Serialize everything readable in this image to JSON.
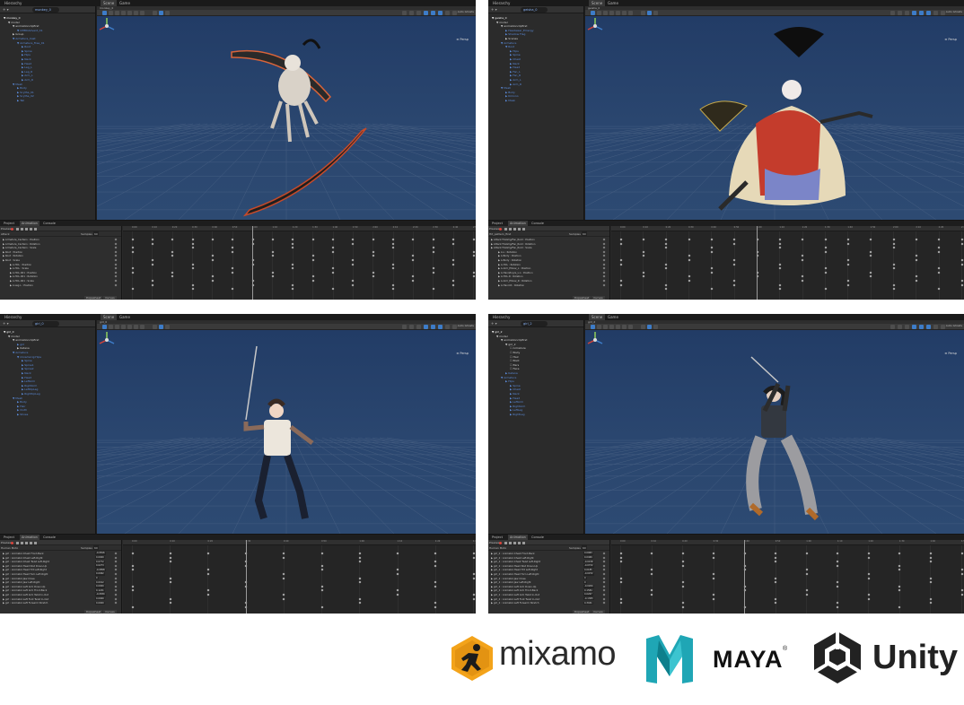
{
  "panels": [
    {
      "tabs": [
        "Hierarchy",
        "Scene",
        "Game"
      ],
      "search": "monkey_0",
      "scene_name": "monkey_0",
      "shading": "Auto Ghosts",
      "hierarchy": [
        {
          "label": "▼ monkey_0",
          "indent": 0,
          "style": "sel"
        },
        {
          "label": "▼ model",
          "indent": 1,
          "style": ""
        },
        {
          "label": "▼ animationclipfirst",
          "indent": 2,
          "style": ""
        },
        {
          "label": "▼ OHMCAdvent_01",
          "indent": 3,
          "style": "blue"
        },
        {
          "label": "▶ Group",
          "indent": 2,
          "style": ""
        },
        {
          "label": "▼ Armature_Cast",
          "indent": 2,
          "style": "blue"
        },
        {
          "label": "▼ Armature_Free_01",
          "indent": 3,
          "style": "blue"
        },
        {
          "label": "▶ Root",
          "indent": 4,
          "style": "blue"
        },
        {
          "label": "▶ Spine",
          "indent": 4,
          "style": "blue"
        },
        {
          "label": "▶ Hips",
          "indent": 4,
          "style": "blue"
        },
        {
          "label": "▶ Neck",
          "indent": 4,
          "style": "blue"
        },
        {
          "label": "▶ Head",
          "indent": 4,
          "style": "blue"
        },
        {
          "label": "▶ Leg_L",
          "indent": 4,
          "style": "blue"
        },
        {
          "label": "▶ Leg_R",
          "indent": 4,
          "style": "blue"
        },
        {
          "label": "▶ Arm_L",
          "indent": 4,
          "style": "blue"
        },
        {
          "label": "▶ Arm_R",
          "indent": 4,
          "style": "blue"
        },
        {
          "label": "▼ Mesh",
          "indent": 2,
          "style": "blue"
        },
        {
          "label": "▶ Body",
          "indent": 3,
          "style": "blue"
        },
        {
          "label": "▶ Scythe_01",
          "indent": 3,
          "style": "blue"
        },
        {
          "label": "▶ Scythe_02",
          "indent": 3,
          "style": "blue"
        },
        {
          "label": "▶ Tail",
          "indent": 3,
          "style": "blue"
        }
      ],
      "bottom_tabs": [
        "Project",
        "Animation",
        "Console"
      ],
      "clip": "Attack",
      "samples": "60",
      "properties": [
        "▶ Armature_Cactwin : Position",
        "▶ Armature_Cactwin : Rotation",
        "▶ Armature_Cactwin : Scale",
        "▶ Root : Position",
        "▶ Root : Rotation",
        "▶ Root : Scale",
        "▶ A.HCL : Position",
        "▶ A.HCL : Scale",
        "▶ A.HCL.001 : Position",
        "▶ A.HCL.001 : Rotation",
        "▶ A.HCL.001 : Scale",
        "▶ A.Leg.L : Position"
      ],
      "ruler": [
        "0:00",
        "0:10",
        "0:20",
        "0:30",
        "0:40",
        "0:50",
        "1:00",
        "1:10",
        "1:20",
        "1:30",
        "1:40",
        "1:50",
        "2:00",
        "2:10",
        "2:20",
        "2:30",
        "2:40",
        "2:50"
      ],
      "buttons": [
        "Dopesheet",
        "Curves"
      ]
    },
    {
      "tabs": [
        "Hierarchy",
        "Scene",
        "Game"
      ],
      "search": "geisha_0",
      "scene_name": "geisha_0",
      "shading": "Auto Ghosts",
      "hierarchy": [
        {
          "label": "▼ geisha_0",
          "indent": 0,
          "style": "sel"
        },
        {
          "label": "▼ model",
          "indent": 1,
          "style": ""
        },
        {
          "label": "▼ animationclipfirst",
          "indent": 2,
          "style": ""
        },
        {
          "label": "▶ Headwear_Emergy",
          "indent": 3,
          "style": "blue"
        },
        {
          "label": "▶ Shadow Flag",
          "indent": 3,
          "style": "blue"
        },
        {
          "label": "▶ Scenes",
          "indent": 3,
          "style": ""
        },
        {
          "label": "▼ Armature",
          "indent": 2,
          "style": "blue"
        },
        {
          "label": "▼ Root",
          "indent": 3,
          "style": "blue"
        },
        {
          "label": "▶ Hips",
          "indent": 4,
          "style": "blue"
        },
        {
          "label": "▶ Spine",
          "indent": 4,
          "style": "blue"
        },
        {
          "label": "▶ Chest",
          "indent": 4,
          "style": "blue"
        },
        {
          "label": "▶ Neck",
          "indent": 4,
          "style": "blue"
        },
        {
          "label": "▶ Head",
          "indent": 4,
          "style": "blue"
        },
        {
          "label": "▶ Fan_L",
          "indent": 4,
          "style": "blue"
        },
        {
          "label": "▶ Fan_R",
          "indent": 4,
          "style": "blue"
        },
        {
          "label": "▶ Arm_L",
          "indent": 4,
          "style": "blue"
        },
        {
          "label": "▶ Arm_R",
          "indent": 4,
          "style": "blue"
        },
        {
          "label": "▼ Mesh",
          "indent": 2,
          "style": "blue"
        },
        {
          "label": "▶ Body",
          "indent": 3,
          "style": "blue"
        },
        {
          "label": "▶ Kimono",
          "indent": 3,
          "style": "blue"
        },
        {
          "label": "▶ Mask",
          "indent": 3,
          "style": "blue"
        }
      ],
      "bottom_tabs": [
        "Project",
        "Animation",
        "Console"
      ],
      "clip": "Hit_pattern_first",
      "samples": "60",
      "properties": [
        "▶ Attack FireGhg/Fan_Root : Position",
        "▶ Attack FireGhg/Fan_Root : Rotation",
        "▶ Attack FireGhg/Fan_Root : Scale",
        "▶ A.L : Rotation",
        "▶ A.Body : Position",
        "▶ A.Body : Rotation",
        "▶ A.HCL : Rotation",
        "▶ A.Arm_Elbow_L : Position",
        "▶ A.Hand/Ingrs_L.L : Position",
        "▶ A.HCL.R : Rotation",
        "▶ A.Arm_Elbow_R : Rotation",
        "▶ A.Hand.R : Rotation"
      ],
      "ruler": [
        "0:00",
        "0:10",
        "0:20",
        "0:30",
        "0:40",
        "0:50",
        "1:00",
        "1:10",
        "1:20",
        "1:30",
        "1:40",
        "1:50",
        "2:00",
        "2:10",
        "2:20",
        "2:30"
      ],
      "buttons": [
        "Dopesheet",
        "Curves"
      ]
    },
    {
      "tabs": [
        "Hierarchy",
        "Scene",
        "Game"
      ],
      "search": "girl_0",
      "scene_name": "girl_0",
      "shading": "Auto Ghosts",
      "hierarchy": [
        {
          "label": "▼ girl_0",
          "indent": 0,
          "style": "sel"
        },
        {
          "label": "▼ model",
          "indent": 1,
          "style": ""
        },
        {
          "label": "▼ animationclipfirst",
          "indent": 2,
          "style": ""
        },
        {
          "label": "▶ girl",
          "indent": 3,
          "style": "blue"
        },
        {
          "label": "▶ Katana",
          "indent": 3,
          "style": ""
        },
        {
          "label": "▼ Armature",
          "indent": 2,
          "style": "blue"
        },
        {
          "label": "▼ mixamorig:Hips",
          "indent": 3,
          "style": "blue"
        },
        {
          "label": "▶ Spine",
          "indent": 4,
          "style": "blue"
        },
        {
          "label": "▶ Spine1",
          "indent": 4,
          "style": "blue"
        },
        {
          "label": "▶ Spine2",
          "indent": 4,
          "style": "blue"
        },
        {
          "label": "▶ Neck",
          "indent": 4,
          "style": "blue"
        },
        {
          "label": "▶ Head",
          "indent": 4,
          "style": "blue"
        },
        {
          "label": "▶ LeftArm",
          "indent": 4,
          "style": "blue"
        },
        {
          "label": "▶ RightArm",
          "indent": 4,
          "style": "blue"
        },
        {
          "label": "▶ LeftUpLeg",
          "indent": 4,
          "style": "blue"
        },
        {
          "label": "▶ RightUpLeg",
          "indent": 4,
          "style": "blue"
        },
        {
          "label": "▼ Mesh",
          "indent": 2,
          "style": "blue"
        },
        {
          "label": "▶ Body",
          "indent": 3,
          "style": "blue"
        },
        {
          "label": "▶ Hair",
          "indent": 3,
          "style": "blue"
        },
        {
          "label": "▶ Cloth",
          "indent": 3,
          "style": "blue"
        },
        {
          "label": "▶ Shoes",
          "indent": 3,
          "style": "blue"
        }
      ],
      "bottom_tabs": [
        "Project",
        "Animation",
        "Console"
      ],
      "clip": "Human Moto",
      "samples": "60",
      "properties": [
        "▶ girl : Animator.Chest Front-Back",
        "▶ girl : Animator.Chest Left-Right",
        "▶ girl : Animator.Chest Twist Left-Right",
        "▶ girl : Animator.Head Nod Down-Up",
        "▶ girl : Animator.Head Tilt Left-Right",
        "▶ girl : Animator.Head Turn Left-Right",
        "▶ girl : Animator.Jaw Close",
        "▶ girl : Animator.Jaw Left-Right",
        "▶ girl : Animator.Left Arm Down-Up",
        "▶ girl : Animator.Left Arm Front-Back",
        "▶ girl : Animator.Left Arm Twist In-Out",
        "▶ girl : Animator.Left Foot Twist In-Out",
        "▶ girl : Animator.Left Forearm Stretch"
      ],
      "values": [
        "-0.0816",
        "0.0000",
        "0.0772",
        "0.0273",
        "-0.0858",
        "0.0062",
        "0",
        "0.0012",
        "0.0000",
        "0.1241",
        "-0.0830",
        "0.0000",
        "0.0000"
      ],
      "ruler": [
        "0:00",
        "0:10",
        "0:20",
        "0:30",
        "0:40",
        "0:50",
        "1:00",
        "1:10",
        "1:20",
        "1:30"
      ],
      "buttons": [
        "Dopesheet",
        "Curves"
      ]
    },
    {
      "tabs": [
        "Hierarchy",
        "Scene",
        "Game"
      ],
      "search": "girl_2",
      "scene_name": "girl_2",
      "shading": "Auto Ghosts",
      "hierarchy": [
        {
          "label": "▼ girl_2",
          "indent": 0,
          "style": "sel"
        },
        {
          "label": "▼ model",
          "indent": 1,
          "style": ""
        },
        {
          "label": "▼ animationclipfirst",
          "indent": 2,
          "style": ""
        },
        {
          "label": "▼ girl_2",
          "indent": 3,
          "style": ""
        },
        {
          "label": "☐ Armature",
          "indent": 4,
          "style": ""
        },
        {
          "label": "☐ Body",
          "indent": 4,
          "style": ""
        },
        {
          "label": "☐ Hair",
          "indent": 4,
          "style": ""
        },
        {
          "label": "☐ Boot",
          "indent": 4,
          "style": ""
        },
        {
          "label": "☐ Ears",
          "indent": 4,
          "style": ""
        },
        {
          "label": "☐ Face",
          "indent": 4,
          "style": ""
        },
        {
          "label": "▶ Katana",
          "indent": 3,
          "style": "blue"
        },
        {
          "label": "▼ Armature",
          "indent": 2,
          "style": "blue"
        },
        {
          "label": "▶ Hips",
          "indent": 3,
          "style": "blue"
        },
        {
          "label": "▶ Spine",
          "indent": 4,
          "style": "blue"
        },
        {
          "label": "▶ Chest",
          "indent": 4,
          "style": "blue"
        },
        {
          "label": "▶ Neck",
          "indent": 4,
          "style": "blue"
        },
        {
          "label": "▶ Head",
          "indent": 4,
          "style": "blue"
        },
        {
          "label": "▶ LeftArm",
          "indent": 4,
          "style": "blue"
        },
        {
          "label": "▶ RightArm",
          "indent": 4,
          "style": "blue"
        },
        {
          "label": "▶ LeftLeg",
          "indent": 4,
          "style": "blue"
        },
        {
          "label": "▶ RightLeg",
          "indent": 4,
          "style": "blue"
        }
      ],
      "bottom_tabs": [
        "Project",
        "Animation",
        "Console"
      ],
      "clip": "Human Moto",
      "samples": "60",
      "properties": [
        "▶ girl_2 : Animator.Chest Front-Back",
        "▶ girl_2 : Animator.Chest Left-Right",
        "▶ girl_2 : Animator.Chest Twist Left-Right",
        "▶ girl_2 : Animator.Head Nod Down-Up",
        "▶ girl_2 : Animator.Head Tilt Left-Right",
        "▶ girl_2 : Animator.Head Turn Left-Right",
        "▶ girl_2 : Animator.Jaw Close",
        "▶ girl_2 : Animator.Jaw Left-Right",
        "▶ girl_2 : Animator.Left Arm Down-Up",
        "▶ girl_2 : Animator.Left Arm Front-Back",
        "▶ girl_2 : Animator.Left Arm Twist In-Out",
        "▶ girl_2 : Animator.Left Foot Twist In-Out",
        "▶ girl_2 : Animator.Left Forearm Stretch"
      ],
      "values": [
        "0.0963",
        "0.0469",
        "-0.0158",
        "-0.0372",
        "0.0185",
        "-0.0072",
        "0",
        "0",
        "-0.0264",
        "0.1584",
        "0.0267",
        "-0.1383",
        "0.3041"
      ],
      "ruler": [
        "0:00",
        "0:10",
        "0:20",
        "0:30",
        "0:40",
        "0:50",
        "1:00",
        "1:10",
        "1:20",
        "1:30",
        "1:40",
        "1:50"
      ],
      "buttons": [
        "Dopesheet",
        "Curves"
      ]
    }
  ],
  "logos": {
    "mixamo": "mixamo",
    "maya": "MAYA",
    "maya_mark": "®",
    "unity": "Unity"
  },
  "colors": {
    "viewport": "#2a466f",
    "editor_dark": "#1f1f1f",
    "mixamo_orange": "#f3a31a",
    "maya_teal": "#1fa6b5"
  }
}
